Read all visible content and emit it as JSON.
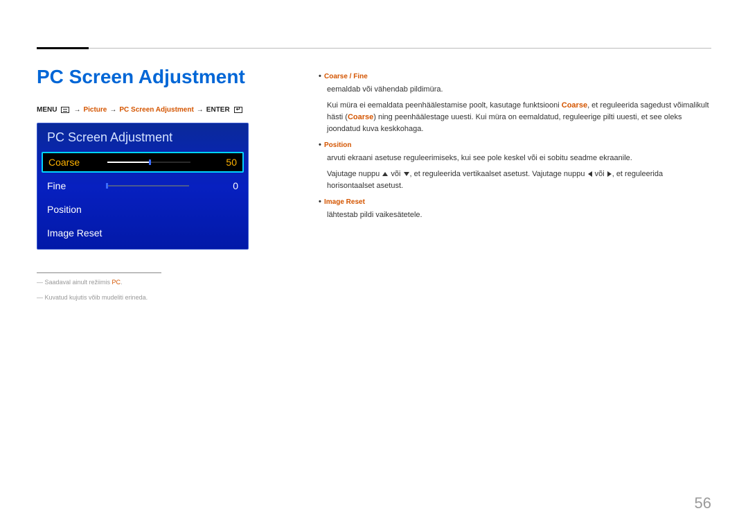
{
  "title": "PC Screen Adjustment",
  "breadcrumb": {
    "menu": "MENU",
    "arrow": "→",
    "picture": "Picture",
    "pcsa": "PC Screen Adjustment",
    "enter": "ENTER"
  },
  "osd": {
    "header": "PC Screen Adjustment",
    "rows": [
      {
        "label": "Coarse",
        "value": "50",
        "fill": 50,
        "selected": true,
        "slider": true
      },
      {
        "label": "Fine",
        "value": "0",
        "fill": 0,
        "selected": false,
        "slider": true
      },
      {
        "label": "Position",
        "value": "",
        "selected": false,
        "slider": false
      },
      {
        "label": "Image Reset",
        "value": "",
        "selected": false,
        "slider": false
      }
    ]
  },
  "footnotes": {
    "f1_pre": "― Saadaval ainult režiimis ",
    "f1_hl": "PC",
    "f1_post": ".",
    "f2": "― Kuvatud kujutis võib mudeliti erineda."
  },
  "right": {
    "h1": "Coarse / Fine",
    "p1a": "eemaldab või vähendab pildimüra.",
    "p1b_pre": "Kui müra ei eemaldata peenhäälestamise poolt, kasutage funktsiooni ",
    "p1b_hl1": "Coarse",
    "p1b_mid": ", et reguleerida sagedust võimalikult hästi (",
    "p1b_hl2": "Coarse",
    "p1b_post": ") ning peenhäälestage uuesti. Kui müra on eemaldatud, reguleerige pilti uuesti, et see oleks joondatud kuva keskkohaga.",
    "h2": "Position",
    "p2a": "arvuti ekraani asetuse reguleerimiseks, kui see pole keskel või ei sobitu seadme ekraanile.",
    "p2b_pre": "Vajutage nuppu ",
    "p2b_mid1": " või ",
    "p2b_mid2": ", et reguleerida vertikaalset asetust. Vajutage nuppu ",
    "p2b_mid3": " või ",
    "p2b_post": ", et reguleerida horisontaalset asetust.",
    "h3": "Image Reset",
    "p3": "lähtestab pildi vaikesätetele."
  },
  "page_number": "56"
}
